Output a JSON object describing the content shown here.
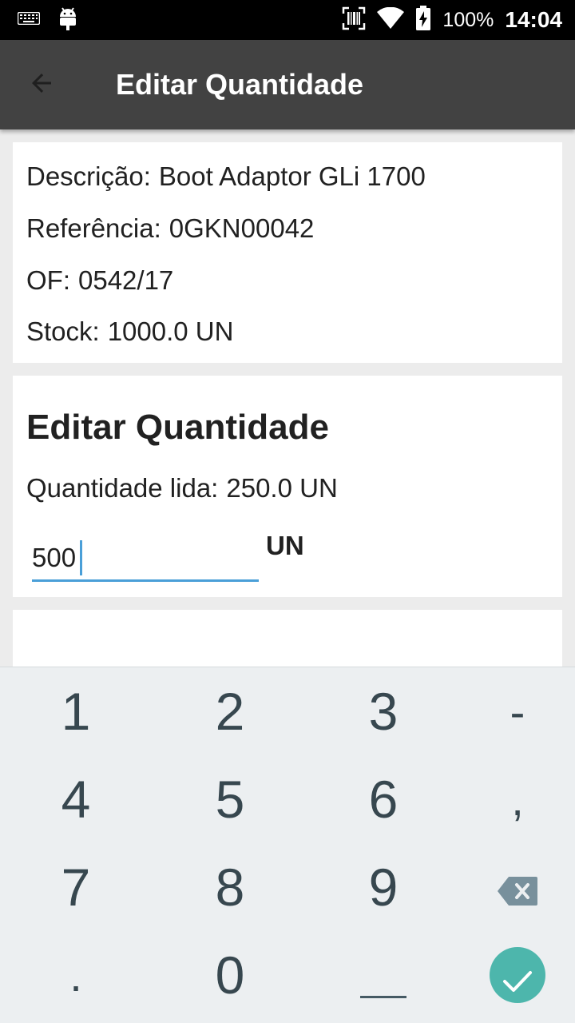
{
  "status_bar": {
    "battery_pct": "100%",
    "time": "14:04",
    "icons": [
      "keyboard-icon",
      "android-icon",
      "scanner-icon",
      "wifi-icon",
      "battery-charging-icon"
    ]
  },
  "app_bar": {
    "title": "Editar Quantidade",
    "back_icon": "arrow-back-icon"
  },
  "info": {
    "descricao_label": "Descrição:",
    "descricao_value": "Boot Adaptor GLi 1700",
    "referencia_label": "Referência:",
    "referencia_value": "0GKN00042",
    "of_label": "OF:",
    "of_value": "0542/17",
    "stock_label": "Stock:",
    "stock_value": "1000.0 UN"
  },
  "edit": {
    "heading": "Editar Quantidade",
    "qty_read_label": "Quantidade lida:",
    "qty_read_value": "250.0 UN",
    "input_value": "500",
    "unit": "UN"
  },
  "keypad": {
    "keys": {
      "k1": "1",
      "k2": "2",
      "k3": "3",
      "minus": "-",
      "k4": "4",
      "k5": "5",
      "k6": "6",
      "comma": ",",
      "k7": "7",
      "k8": "8",
      "k9": "9",
      "dot": ".",
      "k0": "0"
    },
    "backspace_icon": "backspace-icon",
    "space_icon": "space-icon",
    "done_icon": "checkmark-icon",
    "accent_color": "#4db6ac"
  },
  "colors": {
    "app_bar": "#424242",
    "input_underline": "#4a9fd8"
  }
}
